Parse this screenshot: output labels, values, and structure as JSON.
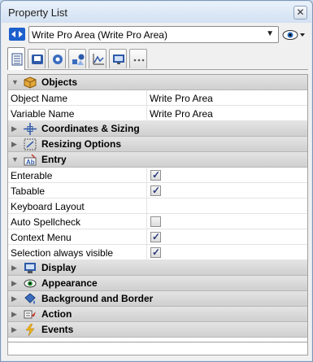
{
  "window": {
    "title": "Property List",
    "close_label": "✕"
  },
  "selector": {
    "value": "Write Pro Area (Write Pro Area)"
  },
  "tabs": [
    {
      "icon": "property-list-icon"
    },
    {
      "icon": "disk-icon"
    },
    {
      "icon": "gear-icon"
    },
    {
      "icon": "shapes-icon"
    },
    {
      "icon": "graph-icon"
    },
    {
      "icon": "monitor-icon"
    },
    {
      "icon": "more-icon"
    }
  ],
  "groups": {
    "objects": "Objects",
    "coordinates": "Coordinates & Sizing",
    "resizing": "Resizing Options",
    "entry": "Entry",
    "display": "Display",
    "appearance": "Appearance",
    "background": "Background and Border",
    "action": "Action",
    "events": "Events"
  },
  "properties": {
    "object_name": {
      "label": "Object Name",
      "value": "Write Pro Area"
    },
    "variable_name": {
      "label": "Variable Name",
      "value": "Write Pro Area"
    },
    "enterable": {
      "label": "Enterable",
      "checked": true
    },
    "tabable": {
      "label": "Tabable",
      "checked": true
    },
    "keyboard_layout": {
      "label": "Keyboard Layout",
      "value": ""
    },
    "auto_spellcheck": {
      "label": "Auto Spellcheck",
      "checked": false
    },
    "context_menu": {
      "label": "Context Menu",
      "checked": true
    },
    "selection_visible": {
      "label": "Selection always visible",
      "checked": true
    }
  },
  "check_mark": "✓"
}
